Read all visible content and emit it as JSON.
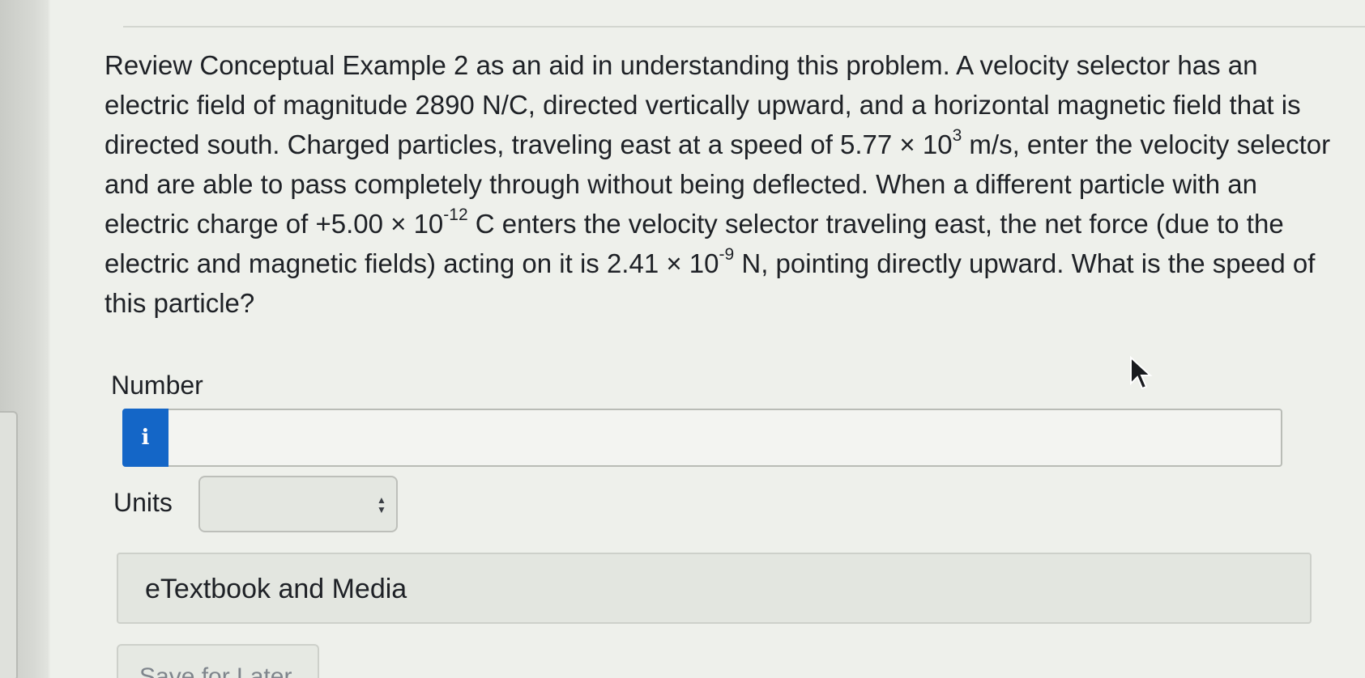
{
  "question": {
    "seg1": "Review Conceptual Example 2 as an aid in understanding this problem. A velocity selector has an electric field of magnitude 2890 N/C, directed vertically upward, and a horizontal magnetic field that is directed south. Charged particles, traveling east at a speed of 5.77 × 10",
    "exp1": "3",
    "seg2": " m/s, enter the velocity selector and are able to pass completely through without being deflected. When a different particle with an electric charge of +5.00 × 10",
    "exp2": "-12",
    "seg3": " C enters the velocity selector traveling east, the net force (due to the electric and magnetic fields) acting on it is 2.41 × 10",
    "exp3": "-9",
    "seg4": " N, pointing directly upward. What is the speed of this particle?"
  },
  "answer": {
    "number_label": "Number",
    "info_button": "i",
    "number_value": "",
    "units_label": "Units",
    "units_value": ""
  },
  "resources": {
    "etextbook_label": "eTextbook and Media"
  },
  "footer": {
    "save_label": "Save for Later"
  },
  "colors": {
    "accent": "#1466c7",
    "background": "#eef0eb"
  },
  "icons": {
    "info": "info-icon",
    "select_arrows": "updown-arrows-icon",
    "cursor": "mouse-pointer-icon"
  }
}
